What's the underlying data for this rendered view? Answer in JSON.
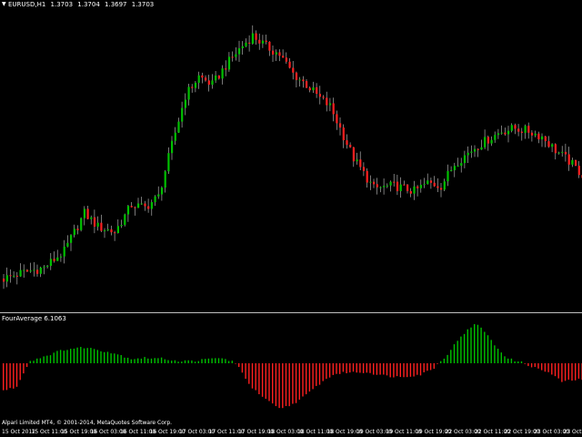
{
  "window": {
    "symbol": "EURUSD,H1",
    "ohlc": [
      "1.3703",
      "1.3704",
      "1.3697",
      "1.3703"
    ]
  },
  "indicator": {
    "label": "FourAverage 6.1063"
  },
  "footer": {
    "copyright": "Alpari Limited MT4, © 2001-2014, MetaQuotes Software Corp."
  },
  "time_axis": [
    "15 Oct 2012",
    "15 Oct 11:00",
    "15 Oct 19:00",
    "16 Oct 03:00",
    "16 Oct 11:00",
    "16 Oct 19:00",
    "17 Oct 03:00",
    "17 Oct 11:00",
    "17 Oct 19:00",
    "18 Oct 03:00",
    "18 Oct 11:00",
    "18 Oct 19:00",
    "19 Oct 03:00",
    "19 Oct 11:00",
    "19 Oct 19:00",
    "22 Oct 03:00",
    "22 Oct 11:00",
    "22 Oct 19:00",
    "23 Oct 03:00",
    "23 Oct"
  ],
  "colors": {
    "background": "#000000",
    "bull": "#00c000",
    "bear": "#ff2020",
    "separator": "#c0c0c0"
  },
  "chart_data": [
    {
      "type": "candlestick",
      "symbol": "EURUSD",
      "timeframe": "H1",
      "close_path": [
        [
          0,
          0.08
        ],
        [
          5,
          0.1
        ],
        [
          12,
          0.12
        ],
        [
          18,
          0.18
        ],
        [
          24,
          0.32
        ],
        [
          28,
          0.27
        ],
        [
          33,
          0.25
        ],
        [
          38,
          0.35
        ],
        [
          42,
          0.34
        ],
        [
          46,
          0.38
        ],
        [
          50,
          0.57
        ],
        [
          54,
          0.75
        ],
        [
          58,
          0.82
        ],
        [
          62,
          0.79
        ],
        [
          66,
          0.86
        ],
        [
          70,
          0.92
        ],
        [
          74,
          0.97
        ],
        [
          78,
          0.93
        ],
        [
          82,
          0.9
        ],
        [
          86,
          0.83
        ],
        [
          90,
          0.79
        ],
        [
          94,
          0.74
        ],
        [
          97,
          0.71
        ],
        [
          100,
          0.63
        ],
        [
          104,
          0.52
        ],
        [
          110,
          0.41
        ],
        [
          116,
          0.42
        ],
        [
          122,
          0.4
        ],
        [
          126,
          0.43
        ],
        [
          130,
          0.42
        ],
        [
          134,
          0.5
        ],
        [
          140,
          0.56
        ],
        [
          144,
          0.59
        ],
        [
          148,
          0.62
        ],
        [
          152,
          0.63
        ],
        [
          156,
          0.62
        ],
        [
          160,
          0.6
        ],
        [
          164,
          0.55
        ],
        [
          168,
          0.51
        ],
        [
          172,
          0.46
        ]
      ]
    },
    {
      "type": "bar",
      "title": "FourAverage 6.1063",
      "path": [
        [
          0,
          -0.6
        ],
        [
          4,
          -0.52
        ],
        [
          6,
          -0.2
        ],
        [
          8,
          0.05
        ],
        [
          12,
          0.15
        ],
        [
          18,
          0.3
        ],
        [
          24,
          0.35
        ],
        [
          28,
          0.3
        ],
        [
          33,
          0.22
        ],
        [
          38,
          0.1
        ],
        [
          42,
          0.12
        ],
        [
          48,
          0.1
        ],
        [
          52,
          0.05
        ],
        [
          56,
          0.05
        ],
        [
          60,
          0.08
        ],
        [
          64,
          0.12
        ],
        [
          68,
          0.05
        ],
        [
          70,
          -0.1
        ],
        [
          74,
          -0.55
        ],
        [
          78,
          -0.8
        ],
        [
          82,
          -1.0
        ],
        [
          86,
          -0.9
        ],
        [
          90,
          -0.7
        ],
        [
          94,
          -0.45
        ],
        [
          98,
          -0.25
        ],
        [
          102,
          -0.2
        ],
        [
          108,
          -0.2
        ],
        [
          114,
          -0.28
        ],
        [
          118,
          -0.3
        ],
        [
          124,
          -0.25
        ],
        [
          128,
          -0.1
        ],
        [
          132,
          0.2
        ],
        [
          136,
          0.6
        ],
        [
          140,
          0.85
        ],
        [
          142,
          0.8
        ],
        [
          146,
          0.4
        ],
        [
          150,
          0.1
        ],
        [
          154,
          0.02
        ],
        [
          158,
          -0.1
        ],
        [
          162,
          -0.2
        ],
        [
          166,
          -0.4
        ],
        [
          172,
          -0.35
        ]
      ]
    }
  ]
}
